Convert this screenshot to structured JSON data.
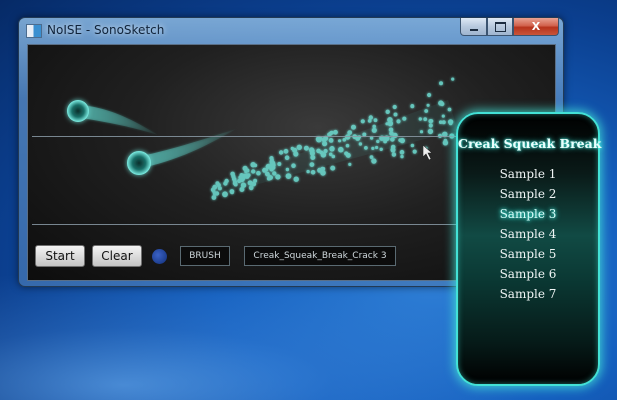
{
  "window": {
    "title": "NoISE - SonoSketch",
    "controls": {
      "minimize": "",
      "maximize": "",
      "close": "X"
    }
  },
  "toolbar": {
    "start_label": "Start",
    "clear_label": "Clear",
    "brush_label": "BRUSH",
    "sample_name": "Creak_Squeak_Break_Crack 3",
    "brush_color": "#2a4fae"
  },
  "popup": {
    "title": "Creak Squeak Break",
    "selected_index": 2,
    "items": [
      {
        "label": "Sample 1"
      },
      {
        "label": "Sample 2"
      },
      {
        "label": "Sample 3"
      },
      {
        "label": "Sample 4"
      },
      {
        "label": "Sample 5"
      },
      {
        "label": "Sample 6"
      },
      {
        "label": "Sample 7"
      }
    ]
  },
  "colors": {
    "accent": "#43e1d6",
    "stroke": "#5fd6cc"
  }
}
